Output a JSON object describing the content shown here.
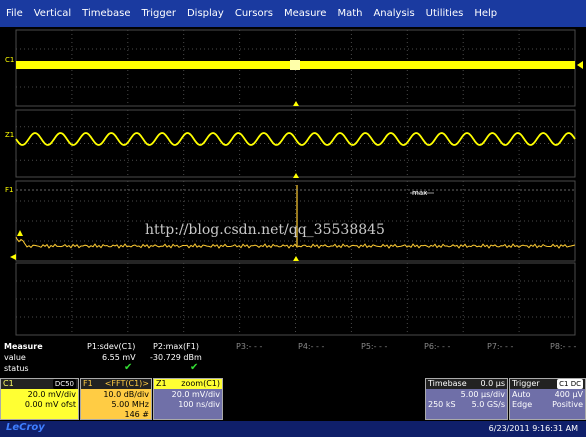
{
  "menu": [
    "File",
    "Vertical",
    "Timebase",
    "Trigger",
    "Display",
    "Cursors",
    "Measure",
    "Math",
    "Analysis",
    "Utilities",
    "Help"
  ],
  "traces": {
    "c1_label": "C1",
    "z1_label": "Z1",
    "f1_label": "F1",
    "max_label": "max"
  },
  "watermark": "http://blog.csdn.net/qq_35538845",
  "colors": {
    "trace": "#ffff00",
    "fft_trace": "#ffcc33",
    "grid": "#4a4a4a",
    "menu_bg": "#1a3aa0"
  },
  "measure": {
    "title": "Measure",
    "row_labels": [
      "value",
      "status"
    ],
    "params": [
      {
        "name": "P1:sdev(C1)",
        "value": "6.55 mV",
        "status": "✔"
      },
      {
        "name": "P2:max(F1)",
        "value": "-30.729 dBm",
        "status": "✔"
      },
      {
        "name": "P3:- - -",
        "value": "",
        "status": ""
      },
      {
        "name": "P4:- - -",
        "value": "",
        "status": ""
      },
      {
        "name": "P5:- - -",
        "value": "",
        "status": ""
      },
      {
        "name": "P6:- - -",
        "value": "",
        "status": ""
      },
      {
        "name": "P7:- - -",
        "value": "",
        "status": ""
      },
      {
        "name": "P8:- - -",
        "value": "",
        "status": ""
      }
    ]
  },
  "descriptors": {
    "c1": {
      "name": "C1",
      "badge": "DC50",
      "line1": "20.0 mV/div",
      "line2": "0.00 mV ofst"
    },
    "f1": {
      "name": "F1",
      "title": "<FFT(C1)>",
      "line1": "10.0 dB/div",
      "line2": "5.00 MHz",
      "line3": "146 #"
    },
    "z1": {
      "name": "Z1",
      "title": "zoom(C1)",
      "line1": "20.0 mV/div",
      "line2": "100 ns/div"
    },
    "timebase": {
      "title": "Timebase",
      "delay": "0.0 µs",
      "line1": "5.00 µs/div",
      "samples": "250 kS",
      "rate": "5.0 GS/s"
    },
    "trigger": {
      "title": "Trigger",
      "badge": "C1 DC",
      "mode": "Auto",
      "level": "400 µV",
      "type": "Edge",
      "slope": "Positive"
    }
  },
  "status_bar": {
    "logo": "LeCroy",
    "datetime": "6/23/2011 9:16:31 AM"
  }
}
